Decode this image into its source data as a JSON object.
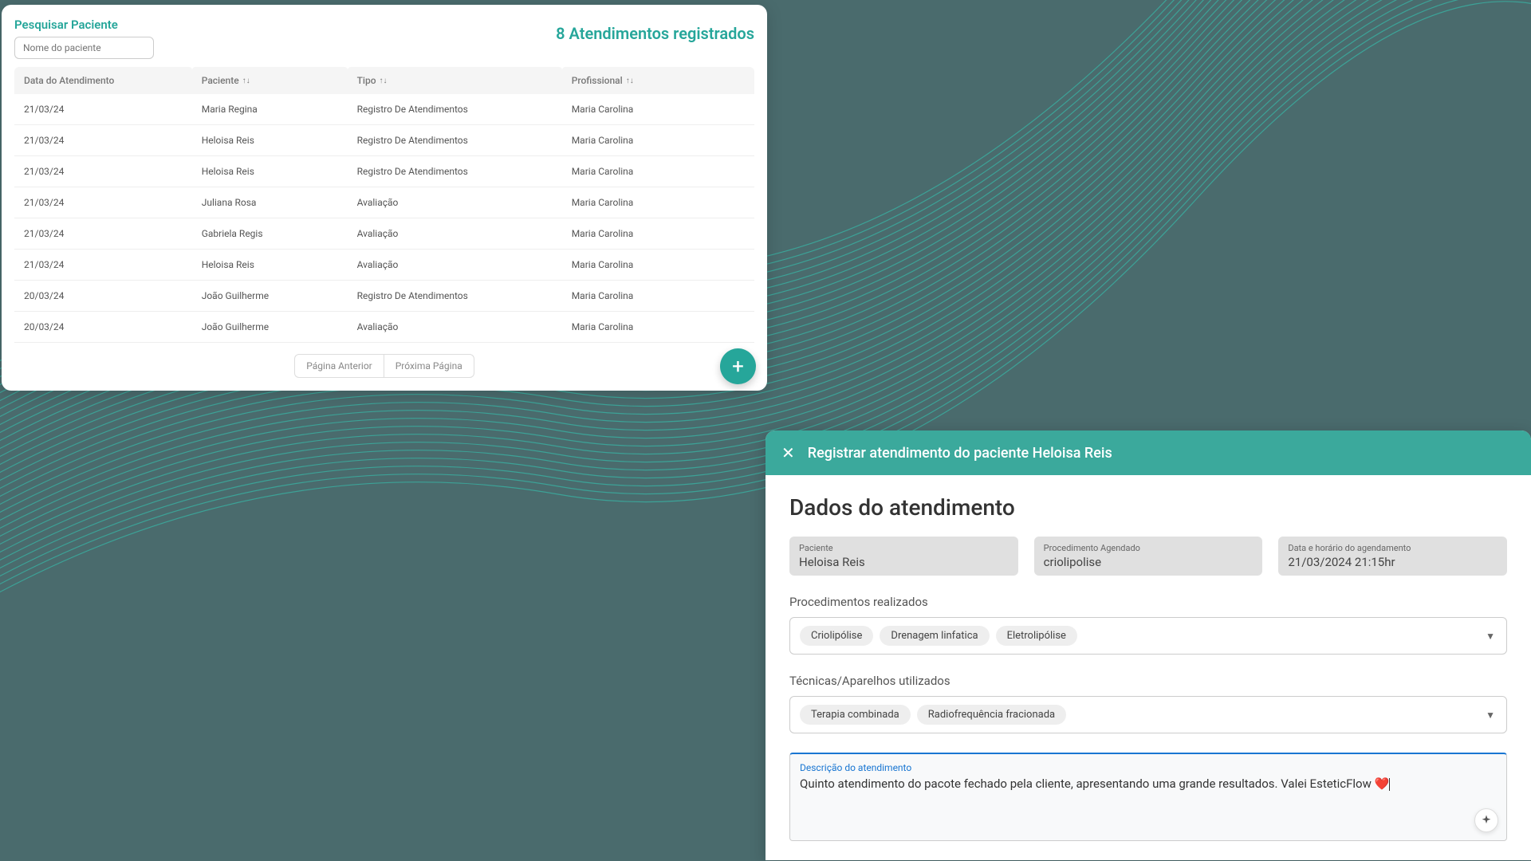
{
  "list": {
    "search_title": "Pesquisar Paciente",
    "search_placeholder": "Nome do paciente",
    "count_title": "8 Atendimentos registrados",
    "columns": {
      "date": "Data do Atendimento",
      "patient": "Paciente",
      "type": "Tipo",
      "professional": "Profissional"
    },
    "rows": [
      {
        "date": "21/03/24",
        "patient": "Maria Regina",
        "type": "Registro De Atendimentos",
        "professional": "Maria Carolina"
      },
      {
        "date": "21/03/24",
        "patient": "Heloisa Reis",
        "type": "Registro De Atendimentos",
        "professional": "Maria Carolina"
      },
      {
        "date": "21/03/24",
        "patient": "Heloisa Reis",
        "type": "Registro De Atendimentos",
        "professional": "Maria Carolina"
      },
      {
        "date": "21/03/24",
        "patient": "Juliana Rosa",
        "type": "Avaliação",
        "professional": "Maria Carolina"
      },
      {
        "date": "21/03/24",
        "patient": "Gabriela Regis",
        "type": "Avaliação",
        "professional": "Maria Carolina"
      },
      {
        "date": "21/03/24",
        "patient": "Heloisa Reis",
        "type": "Avaliação",
        "professional": "Maria Carolina"
      },
      {
        "date": "20/03/24",
        "patient": "João Guilherme",
        "type": "Registro De Atendimentos",
        "professional": "Maria Carolina"
      },
      {
        "date": "20/03/24",
        "patient": "João Guilherme",
        "type": "Avaliação",
        "professional": "Maria Carolina"
      }
    ],
    "prev": "Página Anterior",
    "next": "Próxima Página"
  },
  "modal": {
    "title": "Registrar atendimento do paciente Heloisa Reis",
    "section_title": "Dados do atendimento",
    "fields": {
      "patient_label": "Paciente",
      "patient_value": "Heloisa Reis",
      "procedure_label": "Procedimento Agendado",
      "procedure_value": "criolipolise",
      "datetime_label": "Data e horário do agendamento",
      "datetime_value": "21/03/2024 21:15hr"
    },
    "procedures_label": "Procedimentos realizados",
    "procedures": [
      "Criolipólise",
      "Drenagem linfatica",
      "Eletrolipólise"
    ],
    "techniques_label": "Técnicas/Aparelhos utilizados",
    "techniques": [
      "Terapia combinada",
      "Radiofrequência fracionada"
    ],
    "description_label": "Descrição do atendimento",
    "description_value": "Quinto atendimento do pacote fechado pela cliente, apresentando uma grande resultados. Valei EsteticFlow ❤️"
  }
}
